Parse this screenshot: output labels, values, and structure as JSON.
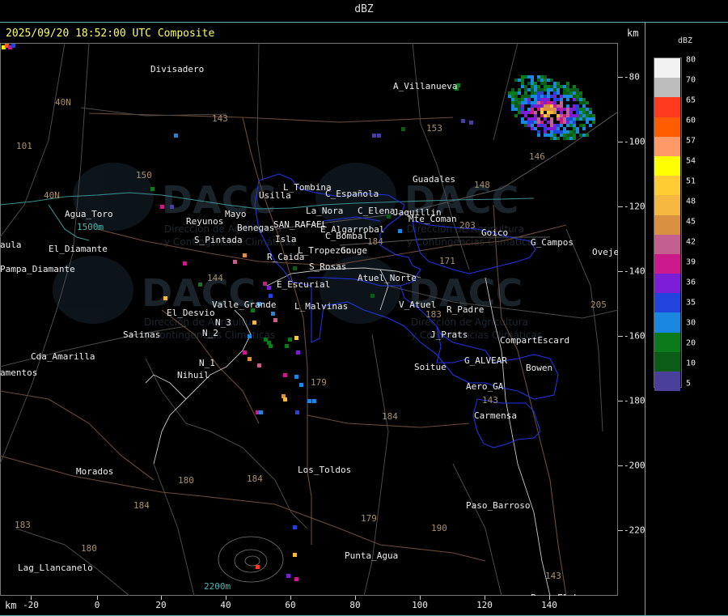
{
  "title": "dBZ",
  "timestamp": "2025/09/20 18:52:00 UTC Composite",
  "axis": {
    "unit": "km",
    "x_ticks": [
      "-20",
      "0",
      "20",
      "40",
      "60",
      "80",
      "100",
      "120",
      "140"
    ],
    "y_ticks": [
      "-80",
      "-100",
      "-120",
      "-140",
      "-160",
      "-180",
      "-200",
      "-220"
    ]
  },
  "legend": {
    "title": "dBZ",
    "levels": [
      {
        "value": "80",
        "color": "#f2f2f2"
      },
      {
        "value": "70",
        "color": "#bdbdbd"
      },
      {
        "value": "65",
        "color": "#ff3a1f"
      },
      {
        "value": "60",
        "color": "#ff5c00"
      },
      {
        "value": "57",
        "color": "#ff9966"
      },
      {
        "value": "54",
        "color": "#ffff00"
      },
      {
        "value": "51",
        "color": "#ffcc33"
      },
      {
        "value": "48",
        "color": "#f5b942"
      },
      {
        "value": "45",
        "color": "#d99040"
      },
      {
        "value": "42",
        "color": "#c46090"
      },
      {
        "value": "39",
        "color": "#cc1a8c"
      },
      {
        "value": "36",
        "color": "#7a1fd6"
      },
      {
        "value": "35",
        "color": "#2244dd"
      },
      {
        "value": "30",
        "color": "#1a88e0"
      },
      {
        "value": "20",
        "color": "#0a7a1a"
      },
      {
        "value": "10",
        "color": "#0b5c16"
      },
      {
        "value": "5",
        "color": "#4a3f9a"
      }
    ]
  },
  "watermark": {
    "brand": "DACC",
    "line1": "Dirección de Agricultura",
    "line2": "y Contingencias Climáticas"
  },
  "places": [
    {
      "name": "Divisadero",
      "color": "#eee"
    },
    {
      "name": "A_Villanueva",
      "color": "#eee"
    },
    {
      "name": "Guadales",
      "color": "#eee"
    },
    {
      "name": "L_Tombina",
      "color": "#eee"
    },
    {
      "name": "Usilla",
      "color": "#eee"
    },
    {
      "name": "C_Española",
      "color": "#eee"
    },
    {
      "name": "La_Nora",
      "color": "#eee"
    },
    {
      "name": "C_Elena",
      "color": "#eee"
    },
    {
      "name": "Jaquillin",
      "color": "#eee"
    },
    {
      "name": "Mte_Coman",
      "color": "#eee"
    },
    {
      "name": "Goico",
      "color": "#eee"
    },
    {
      "name": "G_Campos",
      "color": "#eee"
    },
    {
      "name": "Ovejeros",
      "color": "#eee"
    },
    {
      "name": "Agua_Toro",
      "color": "#eee"
    },
    {
      "name": "Reyunos",
      "color": "#eee"
    },
    {
      "name": "Mayo",
      "color": "#eee"
    },
    {
      "name": "Benegas",
      "color": "#eee"
    },
    {
      "name": "SAN_RAFAEL",
      "color": "#eee"
    },
    {
      "name": "E_Algarrobal",
      "color": "#eee"
    },
    {
      "name": "C_Bombal",
      "color": "#eee"
    },
    {
      "name": "S_Pintada",
      "color": "#eee"
    },
    {
      "name": "Isla",
      "color": "#eee"
    },
    {
      "name": "L_Tropezon",
      "color": "#eee"
    },
    {
      "name": "Gouge",
      "color": "#eee"
    },
    {
      "name": "R_Caida",
      "color": "#eee"
    },
    {
      "name": "S_Rosas",
      "color": "#eee"
    },
    {
      "name": "Atuel_Norte",
      "color": "#eee"
    },
    {
      "name": "Pampa_Diamante",
      "color": "#eee"
    },
    {
      "name": "El_Diamante",
      "color": "#eee"
    },
    {
      "name": "E_Escurial",
      "color": "#eee"
    },
    {
      "name": "Valle_Grande",
      "color": "#eee"
    },
    {
      "name": "L_Malvinas",
      "color": "#eee"
    },
    {
      "name": "V_Atuel",
      "color": "#eee"
    },
    {
      "name": "R_Padre",
      "color": "#eee"
    },
    {
      "name": "El_Desvio",
      "color": "#eee"
    },
    {
      "name": "N_3",
      "color": "#eee"
    },
    {
      "name": "N_2",
      "color": "#eee"
    },
    {
      "name": "Salinas",
      "color": "#eee"
    },
    {
      "name": "J_Prats",
      "color": "#eee"
    },
    {
      "name": "CompartEscard",
      "color": "#eee"
    },
    {
      "name": "Cda_Amarilla",
      "color": "#eee"
    },
    {
      "name": "N_1",
      "color": "#eee"
    },
    {
      "name": "Nihuil",
      "color": "#eee"
    },
    {
      "name": "G_ALVEAR",
      "color": "#eee"
    },
    {
      "name": "Soitue",
      "color": "#eee"
    },
    {
      "name": "Bowen",
      "color": "#eee"
    },
    {
      "name": "Aero_GA",
      "color": "#eee"
    },
    {
      "name": "amentos",
      "color": "#eee"
    },
    {
      "name": "Carmensa",
      "color": "#eee"
    },
    {
      "name": "Morados",
      "color": "#eee"
    },
    {
      "name": "Los_Toldos",
      "color": "#eee"
    },
    {
      "name": "Paso_Barroso",
      "color": "#eee"
    },
    {
      "name": "Punta_Agua",
      "color": "#eee"
    },
    {
      "name": "Lag_Llancanelo",
      "color": "#eee"
    },
    {
      "name": "Paso_El_Loro",
      "color": "#eee"
    },
    {
      "name": "aula",
      "color": "#eee"
    },
    {
      "name": "1500m",
      "color": "#4db8b8"
    },
    {
      "name": "2200m",
      "color": "#4db8b8"
    }
  ],
  "routes": [
    "40N",
    "101",
    "143",
    "150",
    "153",
    "146",
    "148",
    "203",
    "171",
    "40N",
    "144",
    "180",
    "184",
    "179",
    "184",
    "184",
    "183",
    "180",
    "179",
    "190",
    "143",
    "143",
    "205",
    "183",
    "184"
  ]
}
